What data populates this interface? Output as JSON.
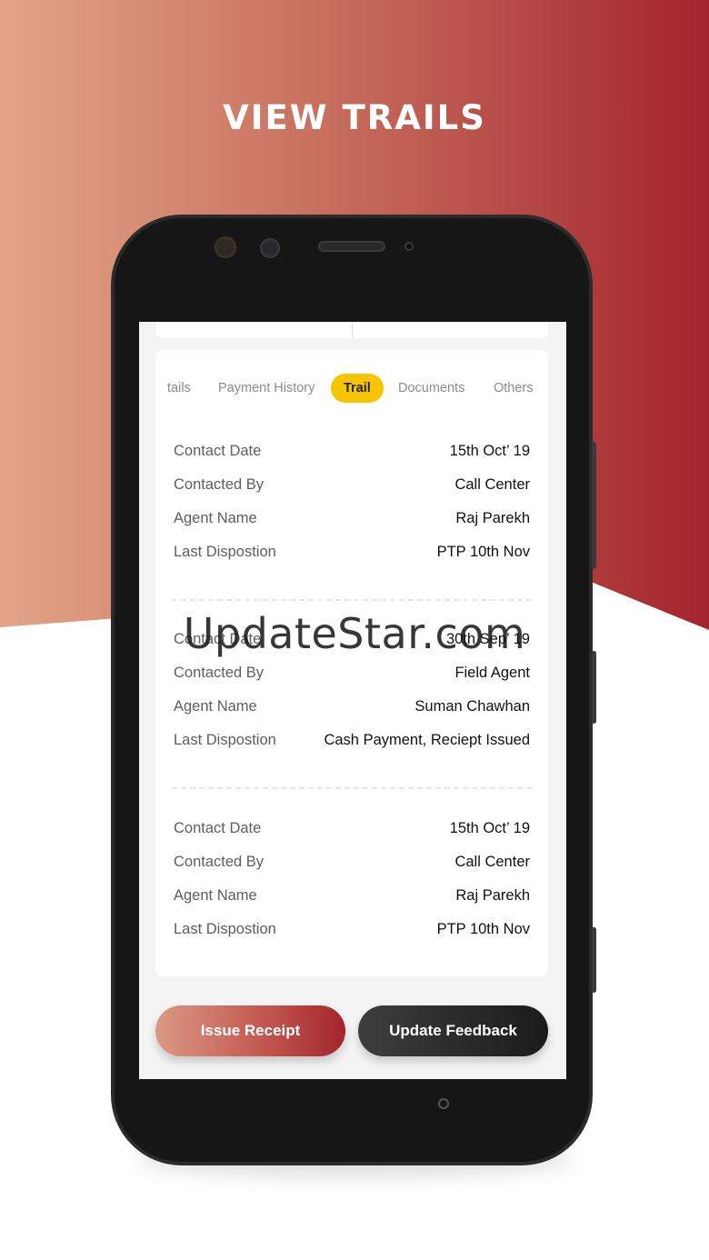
{
  "headline": "VIEW TRAILS",
  "tabs": [
    {
      "label": "tails",
      "active": false
    },
    {
      "label": "Payment History",
      "active": false
    },
    {
      "label": "Trail",
      "active": true
    },
    {
      "label": "Documents",
      "active": false
    },
    {
      "label": "Others",
      "active": false
    }
  ],
  "trails": [
    {
      "rows": [
        {
          "label": "Contact Date",
          "value": "15th Oct’ 19"
        },
        {
          "label": "Contacted By",
          "value": "Call Center"
        },
        {
          "label": "Agent Name",
          "value": "Raj Parekh"
        },
        {
          "label": "Last Dispostion",
          "value": "PTP 10th Nov"
        }
      ]
    },
    {
      "rows": [
        {
          "label": "Contact Date",
          "value": "30th Sep’ 19"
        },
        {
          "label": "Contacted By",
          "value": "Field Agent"
        },
        {
          "label": "Agent Name",
          "value": "Suman Chawhan"
        },
        {
          "label": "Last Dispostion",
          "value": "Cash Payment, Reciept Issued"
        }
      ]
    },
    {
      "rows": [
        {
          "label": "Contact Date",
          "value": "15th Oct’ 19"
        },
        {
          "label": "Contacted By",
          "value": "Call Center"
        },
        {
          "label": "Agent Name",
          "value": "Raj Parekh"
        },
        {
          "label": "Last Dispostion",
          "value": "PTP 10th Nov"
        }
      ]
    }
  ],
  "buttons": {
    "issue_receipt": "Issue Receipt",
    "update_feedback": "Update Feedback"
  },
  "watermark": "UpdateStar.com",
  "colors": {
    "accent_yellow": "#f7c500",
    "brand_red": "#a3242c",
    "brand_peach": "#e3a486"
  }
}
